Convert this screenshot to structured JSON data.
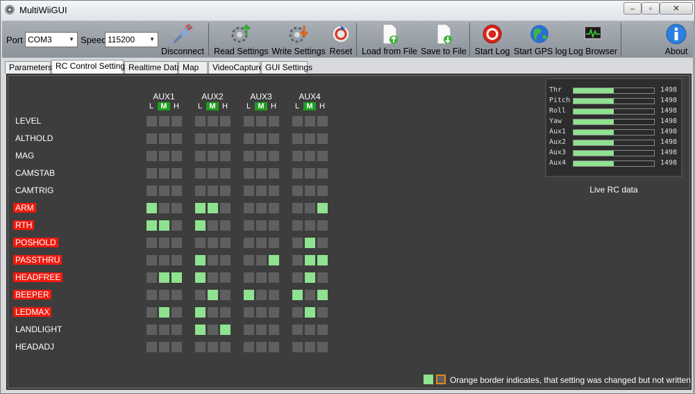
{
  "window": {
    "title": "MultiWiiGUI",
    "min_label": "▭",
    "max_label": "▢",
    "close_label": "✕"
  },
  "toolbar": {
    "port_label": "Port",
    "port_value": "COM3",
    "speed_label": "Speed",
    "speed_value": "115200",
    "buttons": [
      {
        "label": "Disconnect",
        "icon": "plug-icon"
      },
      {
        "label": "Read Settings",
        "icon": "gear-read-icon"
      },
      {
        "label": "Write Settings",
        "icon": "gear-write-icon"
      },
      {
        "label": "Reset",
        "icon": "reset-icon"
      },
      {
        "label": "Load from File",
        "icon": "load-file-icon"
      },
      {
        "label": "Save to File",
        "icon": "save-file-icon"
      },
      {
        "label": "Start Log",
        "icon": "record-icon"
      },
      {
        "label": "Start GPS log",
        "icon": "globe-icon"
      },
      {
        "label": "Log Browser",
        "icon": "monitor-icon"
      },
      {
        "label": "About",
        "icon": "info-icon"
      }
    ]
  },
  "tabs": [
    "Parameters",
    "RC Control Settings",
    "Realtime Data",
    "Map",
    "VideoCapture",
    "GUI Settings"
  ],
  "active_tab": "RC Control Settings",
  "aux": {
    "titles": [
      "AUX1",
      "AUX2",
      "AUX3",
      "AUX4"
    ],
    "positions": [
      "L",
      "M",
      "H"
    ]
  },
  "modes": [
    {
      "name": "LEVEL",
      "highlight": false,
      "cells": [
        0,
        0,
        0,
        0,
        0,
        0,
        0,
        0,
        0,
        0,
        0,
        0
      ]
    },
    {
      "name": "ALTHOLD",
      "highlight": false,
      "cells": [
        0,
        0,
        0,
        0,
        0,
        0,
        0,
        0,
        0,
        0,
        0,
        0
      ]
    },
    {
      "name": "MAG",
      "highlight": false,
      "cells": [
        0,
        0,
        0,
        0,
        0,
        0,
        0,
        0,
        0,
        0,
        0,
        0
      ]
    },
    {
      "name": "CAMSTAB",
      "highlight": false,
      "cells": [
        0,
        0,
        0,
        0,
        0,
        0,
        0,
        0,
        0,
        0,
        0,
        0
      ]
    },
    {
      "name": "CAMTRIG",
      "highlight": false,
      "cells": [
        0,
        0,
        0,
        0,
        0,
        0,
        0,
        0,
        0,
        0,
        0,
        0
      ]
    },
    {
      "name": "ARM",
      "highlight": true,
      "cells": [
        1,
        0,
        0,
        1,
        1,
        0,
        0,
        0,
        0,
        0,
        0,
        1
      ]
    },
    {
      "name": "RTH",
      "highlight": true,
      "cells": [
        1,
        1,
        0,
        1,
        0,
        0,
        0,
        0,
        0,
        0,
        0,
        0
      ]
    },
    {
      "name": "POSHOLD",
      "highlight": true,
      "cells": [
        0,
        0,
        0,
        0,
        0,
        0,
        0,
        0,
        0,
        0,
        1,
        0
      ]
    },
    {
      "name": "PASSTHRU",
      "highlight": true,
      "cells": [
        0,
        0,
        0,
        1,
        0,
        0,
        0,
        0,
        1,
        0,
        1,
        1
      ]
    },
    {
      "name": "HEADFREE",
      "highlight": true,
      "cells": [
        0,
        1,
        1,
        1,
        0,
        0,
        0,
        0,
        0,
        0,
        1,
        0
      ]
    },
    {
      "name": "BEEPER",
      "highlight": true,
      "cells": [
        0,
        0,
        0,
        0,
        1,
        0,
        1,
        0,
        0,
        1,
        0,
        1
      ]
    },
    {
      "name": "LEDMAX",
      "highlight": true,
      "cells": [
        0,
        1,
        0,
        1,
        0,
        0,
        0,
        0,
        0,
        0,
        1,
        0
      ]
    },
    {
      "name": "LANDLIGHT",
      "highlight": false,
      "cells": [
        0,
        0,
        0,
        1,
        0,
        1,
        0,
        0,
        0,
        0,
        0,
        0
      ]
    },
    {
      "name": "HEADADJ",
      "highlight": false,
      "cells": [
        0,
        0,
        0,
        0,
        0,
        0,
        0,
        0,
        0,
        0,
        0,
        0
      ]
    }
  ],
  "live_rc": {
    "caption": "Live RC data",
    "channels": [
      {
        "name": "Thr",
        "value": "1498",
        "level": 0.5
      },
      {
        "name": "Pitch",
        "value": "1498",
        "level": 0.5
      },
      {
        "name": "Roll",
        "value": "1498",
        "level": 0.5
      },
      {
        "name": "Yaw",
        "value": "1498",
        "level": 0.5
      },
      {
        "name": "Aux1",
        "value": "1498",
        "level": 0.5
      },
      {
        "name": "Aux2",
        "value": "1498",
        "level": 0.5
      },
      {
        "name": "Aux3",
        "value": "1498",
        "level": 0.5
      },
      {
        "name": "Aux4",
        "value": "1498",
        "level": 0.5
      }
    ]
  },
  "legend": {
    "text": "Orange border indicates, that setting was changed but not written to FC"
  },
  "colors": {
    "active": "#8fe28f",
    "inactive": "#5f5f5f",
    "highlight": "#ee1a0e",
    "changed_border": "#e08a1e"
  }
}
